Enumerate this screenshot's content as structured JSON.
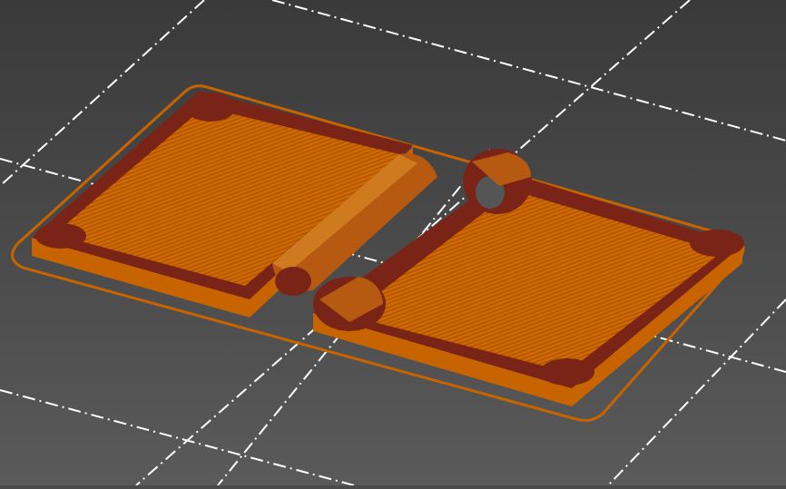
{
  "viewport": {
    "view": "3d-preview",
    "colors": {
      "background_top": "#3a3a3a",
      "background_bottom": "#5a5a5a",
      "grid": "#ffffff",
      "infill": "#d06a00",
      "perimeter": "#7a2418",
      "side": "#c86400",
      "skirt": "#c86400"
    }
  }
}
